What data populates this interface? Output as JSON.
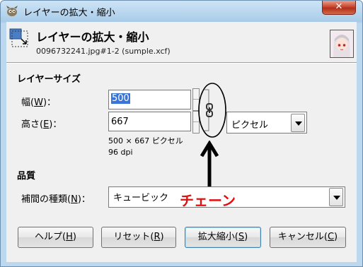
{
  "window": {
    "title": "レイヤーの拡大・縮小",
    "close_label": "✕"
  },
  "header": {
    "title": "レイヤーの拡大・縮小",
    "subtitle": "0096732241.jpg#1-2 (sumple.xcf)"
  },
  "layer_size": {
    "section_label": "レイヤーサイズ",
    "width_label_pre": "幅(",
    "width_label_key": "W",
    "width_label_post": ")：",
    "width_value": "500",
    "height_label_pre": "高さ(",
    "height_label_key": "E",
    "height_label_post": ")：",
    "height_value": "667",
    "unit": "ピクセル",
    "info_size": "500 × 667 ピクセル",
    "info_dpi": "96 dpi"
  },
  "quality": {
    "section_label": "品質",
    "interp_label_pre": "補間の種類(",
    "interp_label_key": "N",
    "interp_label_post": ")：",
    "interp_value": "キュービック"
  },
  "annotation": {
    "text": "チェーン",
    "color": "#e01010"
  },
  "buttons": {
    "help_pre": "ヘルプ(",
    "help_key": "H",
    "help_post": ")",
    "reset_pre": "リセット(",
    "reset_key": "R",
    "reset_post": ")",
    "scale_pre": "拡大縮小(",
    "scale_key": "S",
    "scale_post": ")",
    "cancel_pre": "キャンセル(",
    "cancel_key": "C",
    "cancel_post": ")"
  },
  "icons": {
    "app": "gimp-icon",
    "header": "scale-layer-icon",
    "chain": "chain-link-icon",
    "avatar": "image-thumbnail"
  }
}
